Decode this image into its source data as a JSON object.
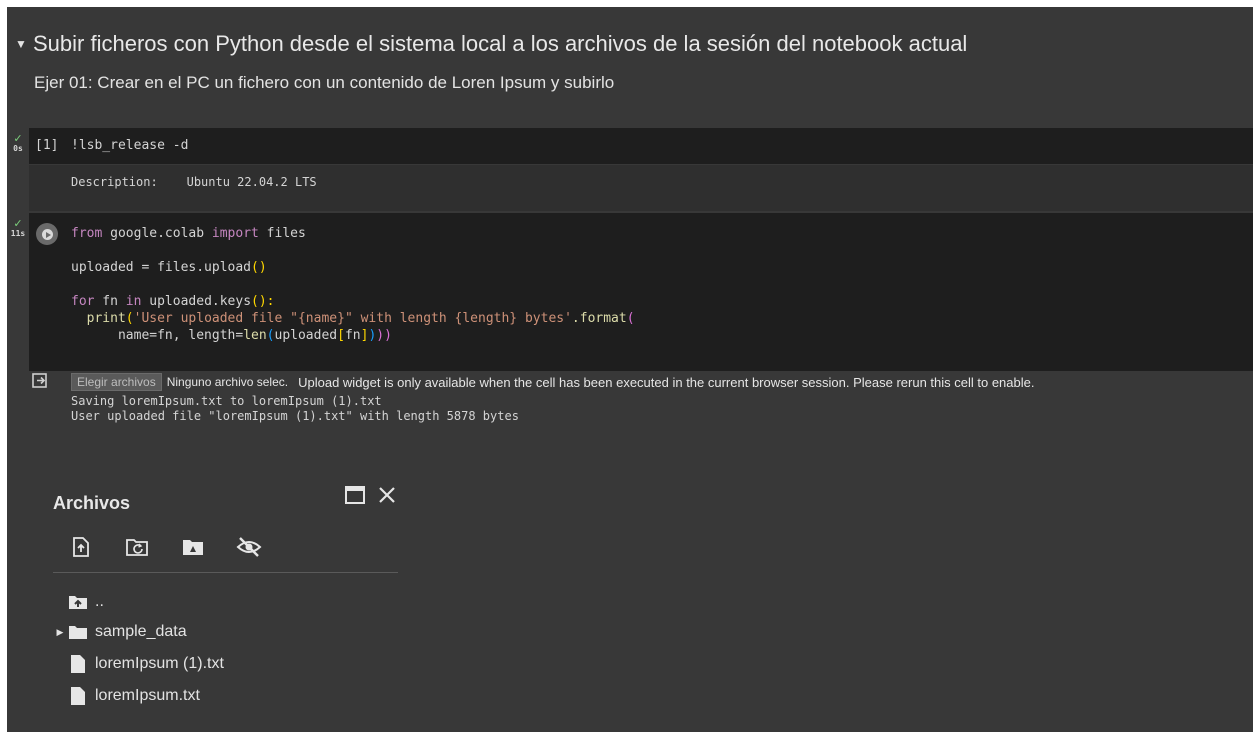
{
  "section": {
    "title": "Subir ficheros con Python desde el sistema local a los archivos de la sesión del notebook actual",
    "subtitle": "Ejer 01: Crear en el PC un fichero con un contenido de Loren Ipsum y subirlo"
  },
  "cell1": {
    "exec_time": "0s",
    "exec_count": "[1]",
    "code": "!lsb_release -d",
    "output": "Description:    Ubuntu 22.04.2 LTS"
  },
  "cell2": {
    "exec_time": "11s",
    "code": {
      "l1_a": "from",
      "l1_b": " google.colab ",
      "l1_c": "import",
      "l1_d": " files",
      "l2_a": "uploaded = files.upload",
      "l2_b": "()",
      "l3_a": "for",
      "l3_b": " fn ",
      "l3_c": "in",
      "l3_d": " uploaded.keys",
      "l3_e": "():",
      "l4_a": "  ",
      "l4_b": "print",
      "l4_c": "(",
      "l4_d": "'User uploaded file \"{name}\" with length {length} bytes'",
      "l4_e": ".format",
      "l4_f": "(",
      "l5_a": "      name=fn, length=",
      "l5_b": "len",
      "l5_c": "(",
      "l5_d": "uploaded",
      "l5_e": "[",
      "l5_f": "fn",
      "l5_g": "]",
      "l5_h": ")",
      "l5_i": "))"
    },
    "output": {
      "choose_button": "Elegir archivos",
      "no_file": "Ninguno archivo selec.",
      "widget_msg": "Upload widget is only available when the cell has been executed in the current browser session. Please rerun this cell to enable.",
      "log_1": "Saving loremIpsum.txt to loremIpsum (1).txt",
      "log_2": "User uploaded file \"loremIpsum (1).txt\" with length 5878 bytes"
    }
  },
  "files_panel": {
    "title": "Archivos",
    "tree": {
      "parent": "..",
      "folder": "sample_data",
      "file_1": "loremIpsum (1).txt",
      "file_2": "loremIpsum.txt"
    }
  },
  "colors": {
    "background": "#383838",
    "code_background": "#1e1e1e",
    "check_green": "#7ccf7c"
  }
}
